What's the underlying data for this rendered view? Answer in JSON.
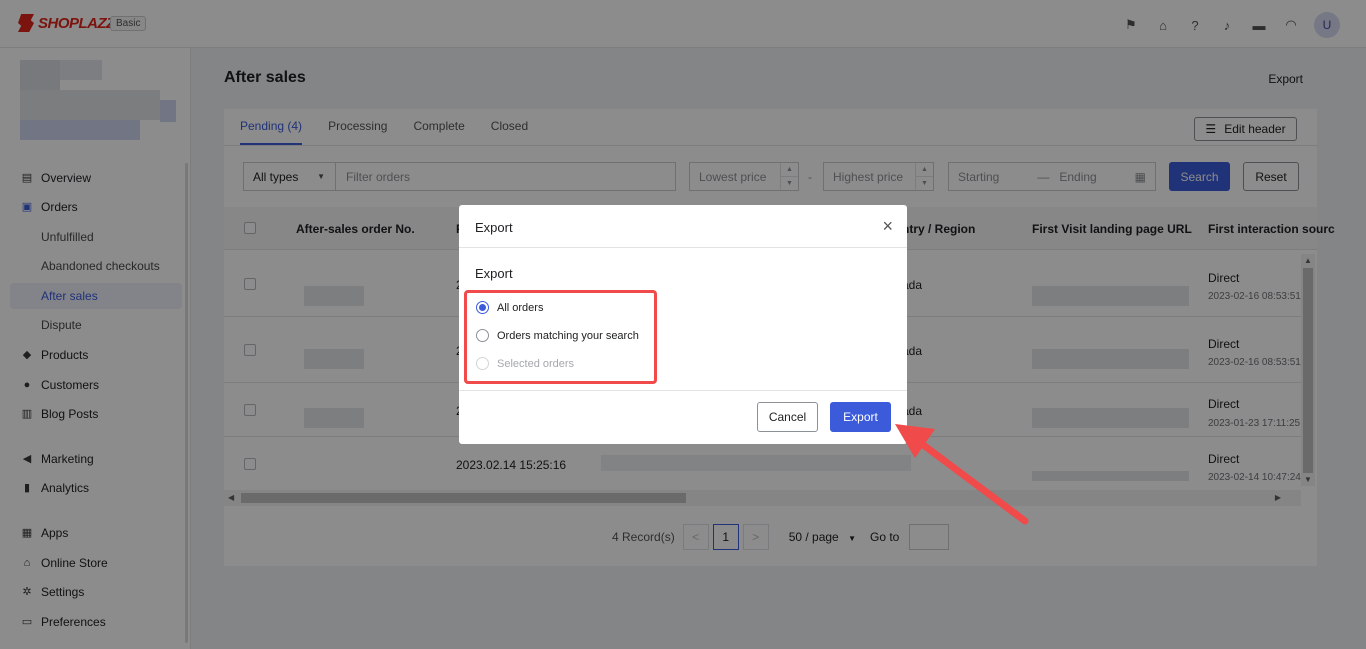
{
  "brand": {
    "name": "SHOPLAZZA",
    "plan": "Basic"
  },
  "topbar": {
    "icons": [
      "flag-icon",
      "store-icon",
      "help-icon",
      "bell-icon",
      "chat-icon",
      "wifi-icon"
    ],
    "avatar_initial": "U"
  },
  "sidebar": {
    "items": [
      {
        "label": "Overview",
        "icon": "overview-icon"
      },
      {
        "label": "Orders",
        "icon": "orders-icon"
      },
      {
        "label": "Unfulfilled"
      },
      {
        "label": "Abandoned checkouts"
      },
      {
        "label": "After sales"
      },
      {
        "label": "Dispute"
      },
      {
        "label": "Products",
        "icon": "products-icon"
      },
      {
        "label": "Customers",
        "icon": "customers-icon"
      },
      {
        "label": "Blog Posts",
        "icon": "blog-icon"
      },
      {
        "label": "Marketing",
        "icon": "marketing-icon"
      },
      {
        "label": "Analytics",
        "icon": "analytics-icon"
      },
      {
        "label": "Apps",
        "icon": "apps-icon"
      },
      {
        "label": "Online Store",
        "icon": "online-store-icon"
      },
      {
        "label": "Settings",
        "icon": "settings-icon"
      },
      {
        "label": "Preferences",
        "icon": "preferences-icon"
      }
    ]
  },
  "page": {
    "title": "After sales",
    "export_label": "Export"
  },
  "tabs": [
    {
      "label": "Pending",
      "count": "(4)"
    },
    {
      "label": "Processing"
    },
    {
      "label": "Complete"
    },
    {
      "label": "Closed"
    }
  ],
  "edit_header_label": "Edit header",
  "filters": {
    "type_value": "All types",
    "search_placeholder": "Filter orders",
    "lowest_placeholder": "Lowest price",
    "price_sep": "-",
    "highest_placeholder": "Highest price",
    "start_placeholder": "Starting",
    "date_sep": "—",
    "end_placeholder": "Ending",
    "search_label": "Search",
    "reset_label": "Reset"
  },
  "table": {
    "columns": [
      "After-sales order No.",
      "F",
      "ntry / Region",
      "First Visit landing page URL",
      "First interaction sourc"
    ],
    "rows": [
      {
        "col2": "2",
        "region": "ada",
        "source": "Direct",
        "source_time": "2023-02-16 08:53:51"
      },
      {
        "col2": "2",
        "region": "ada",
        "source": "Direct",
        "source_time": "2023-02-16 08:53:51"
      },
      {
        "col2": "2",
        "region": "ada",
        "source": "Direct",
        "source_time": "2023-01-23 17:11:25"
      },
      {
        "col2": "2023.02.14 15:25:16",
        "region": "",
        "source": "Direct",
        "source_time": "2023-02-14 10:47:24"
      }
    ]
  },
  "pagination": {
    "records": "4 Record(s)",
    "prev": "<",
    "current": "1",
    "next": ">",
    "per_page": "50 / page",
    "goto_label": "Go to"
  },
  "modal": {
    "title": "Export",
    "close": "×",
    "section_label": "Export",
    "options": [
      {
        "label": "All orders",
        "checked": true,
        "disabled": false
      },
      {
        "label": "Orders matching your search",
        "checked": false,
        "disabled": false
      },
      {
        "label": "Selected orders",
        "checked": false,
        "disabled": true
      }
    ],
    "cancel_label": "Cancel",
    "export_label": "Export"
  },
  "colors": {
    "accent": "#3b5bdb",
    "annotation": "#f04a4a",
    "brand": "#e0251b"
  }
}
